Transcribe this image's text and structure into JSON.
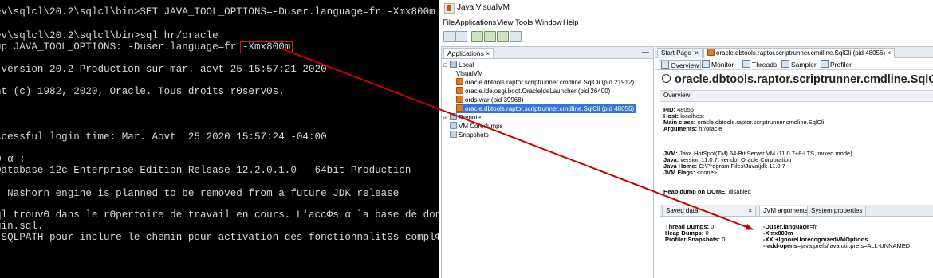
{
  "terminal": {
    "lines": [
      {
        "text": "ev\\sqlcl\\20.2\\sqlcl\\bin>SET JAVA_TOOL_OPTIONS=-Duser.language=fr -Xmx800m"
      },
      {
        "text": ""
      },
      {
        "text": "ev\\sqlcl\\20.2\\sqlcl\\bin>sql hr/oracle"
      },
      {
        "text": "up JAVA_TOOL_OPTIONS: -Duser.language=fr "
      },
      {
        "text": ""
      },
      {
        "text": " version 20.2 Production sur mar. aovt 25 15:57:21 2020"
      },
      {
        "text": ""
      },
      {
        "text": "nt (c) 1982, 2020, Oracle. Tous droits rΘservΘs."
      },
      {
        "text": ""
      },
      {
        "text": ""
      },
      {
        "text": ""
      },
      {
        "text": "ccessful login time: Mar. Aovt  25 2020 15:57:24 -04:00"
      },
      {
        "text": ""
      },
      {
        "text": "Θ α :"
      },
      {
        "text": "Database 12c Enterprise Edition Release 12.2.0.1.0 - 64bit Production"
      },
      {
        "text": ""
      },
      {
        "text": ": Nashorn engine is planned to be removed from a future JDK release"
      },
      {
        "text": ""
      },
      {
        "text": "ql trouvΘ dans le rΘpertoire de travail en cours. L'accΦs α la base de donnΘes"
      },
      {
        "text": "gin.sql."
      },
      {
        "text": " SQLPATH pour inclure le chemin pour activation des fonctionnalitΘs complΦtes."
      }
    ],
    "highlight": "-Xmx800m"
  },
  "window": {
    "title": "Java VisualVM",
    "menu": [
      "File",
      "Applications",
      "View",
      "Tools",
      "Window",
      "Help"
    ]
  },
  "apps_panel": {
    "tab": "Applications",
    "close": "×",
    "minimize": "—",
    "items": [
      {
        "label": "Local",
        "icon": "host-icon"
      },
      {
        "label": "VisualVM",
        "icon": "visualvm-icon"
      },
      {
        "label": "oracle.dbtools.raptor.scriptrunner.cmdline.SqlCli (pid 21912)",
        "icon": "java-app-icon"
      },
      {
        "label": "oracle.ide.osgi.boot.OracleIdeLauncher (pid 26400)",
        "icon": "java-app-icon"
      },
      {
        "label": "ords.war (pid 39968)",
        "icon": "java-app-icon"
      },
      {
        "label": "oracle.dbtools.raptor.scriptrunner.cmdline.SqlCli (pid 48056)",
        "icon": "java-app-icon"
      },
      {
        "label": "Remote",
        "icon": "remote-icon"
      },
      {
        "label": "VM Coredumps",
        "icon": "coredump-icon"
      },
      {
        "label": "Snapshots",
        "icon": "snapshot-icon"
      }
    ]
  },
  "doc_tabs": {
    "start": "Start Page",
    "app": "oracle.dbtools.raptor.scriptrunner.cmdline.SqlCli (pid 48056)",
    "close": "×"
  },
  "subtabs": [
    "Overview",
    "Monitor",
    "Threads",
    "Sampler",
    "Profiler"
  ],
  "main": {
    "title": "oracle.dbtools.raptor.scriptrunner.cmdline.SqlCli (pid",
    "overview_label": "Overview",
    "pid_label": "PID:",
    "pid": "48056",
    "host_label": "Host:",
    "host": "localhost",
    "mainclass_label": "Main class:",
    "mainclass": "oracle.dbtools.raptor.scriptrunner.cmdline.SqlCli",
    "args_label": "Arguments:",
    "args": "hr/oracle",
    "jvm_label": "JVM:",
    "jvm": "Java HotSpot(TM) 64-Bit Server VM (11.0.7+8-LTS, mixed mode)",
    "java_label": "Java:",
    "java": "version 11.0.7, vendor Oracle Corporation",
    "javahome_label": "Java Home:",
    "javahome": "C:\\Program Files\\Java\\jdk-11.0.7",
    "jvmflags_label": "JVM Flags:",
    "jvmflags": "<none>",
    "heapdump_label": "Heap dump on OOME:",
    "heapdump": "disabled"
  },
  "bottom_tabs": {
    "saved": "Saved data",
    "close": "×",
    "jvmargs": "JVM arguments",
    "sysprops": "System properties"
  },
  "saved_data": {
    "thread_label": "Thread Dumps:",
    "thread": "0",
    "heap_label": "Heap Dumps:",
    "heap": "0",
    "profiler_label": "Profiler Snapshots:",
    "profiler": "0"
  },
  "jvm_args": {
    "a1": "-Duser.language",
    "a1v": "=fr",
    "a2": "-Xmx800m",
    "a3": "-XX:+IgnoreUnrecognizedVMOptions",
    "a4": "--add-opens",
    "a4v": "=java.prefs/java.util.prefs=ALL-UNNAMED"
  },
  "colors": {
    "arrow": "#c80000",
    "selection": "#3875d7",
    "terminal_bg": "#000000"
  }
}
